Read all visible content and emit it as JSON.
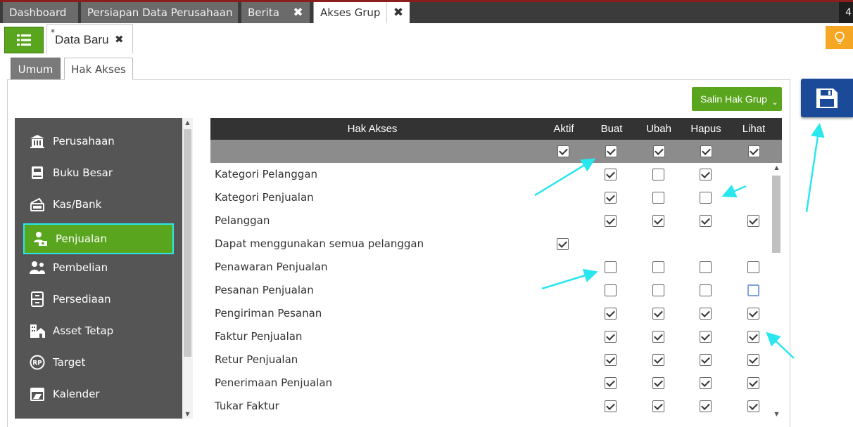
{
  "top_tabs": [
    {
      "label": "Dashboard"
    },
    {
      "label": "Persiapan Data Perusahaan"
    },
    {
      "label": "Berita"
    },
    {
      "label": "Akses Grup"
    }
  ],
  "top_right_text": "4",
  "doc_tab": {
    "modified_marker": "*",
    "label": "Data Baru",
    "close_glyph": "✖"
  },
  "sub_tabs": {
    "umum": "Umum",
    "hak_akses": "Hak Akses"
  },
  "salin_button": {
    "label": "Salin Hak Grup",
    "chevron": "⌄"
  },
  "sidebar": {
    "items": [
      {
        "label": "Perusahaan",
        "icon": "building-icon"
      },
      {
        "label": "Buku Besar",
        "icon": "ledger-icon"
      },
      {
        "label": "Kas/Bank",
        "icon": "cash-icon"
      },
      {
        "label": "Penjualan",
        "icon": "sales-icon",
        "active": true
      },
      {
        "label": "Pembelian",
        "icon": "purchase-icon"
      },
      {
        "label": "Persediaan",
        "icon": "inventory-icon"
      },
      {
        "label": "Asset Tetap",
        "icon": "fixed-asset-icon"
      },
      {
        "label": "Target",
        "icon": "target-rp-icon"
      },
      {
        "label": "Kalender",
        "icon": "calendar-icon"
      }
    ]
  },
  "table": {
    "headers": {
      "hak_akses": "Hak Akses",
      "aktif": "Aktif",
      "buat": "Buat",
      "ubah": "Ubah",
      "hapus": "Hapus",
      "lihat": "Lihat"
    },
    "select_all": {
      "aktif": true,
      "buat": true,
      "ubah": true,
      "hapus": true,
      "lihat": true
    },
    "rows": [
      {
        "label": "Kategori Pelanggan",
        "aktif": null,
        "buat": true,
        "ubah": false,
        "hapus": true,
        "lihat": null
      },
      {
        "label": "Kategori Penjualan",
        "aktif": null,
        "buat": true,
        "ubah": false,
        "hapus": false,
        "lihat": null
      },
      {
        "label": "Pelanggan",
        "aktif": null,
        "buat": true,
        "ubah": true,
        "hapus": true,
        "lihat": true
      },
      {
        "label": "Dapat menggunakan semua pelanggan",
        "aktif": true,
        "buat": null,
        "ubah": null,
        "hapus": null,
        "lihat": null
      },
      {
        "label": "Penawaran Penjualan",
        "aktif": null,
        "buat": false,
        "ubah": false,
        "hapus": false,
        "lihat": false
      },
      {
        "label": "Pesanan Penjualan",
        "aktif": null,
        "buat": false,
        "ubah": false,
        "hapus": false,
        "lihat": false
      },
      {
        "label": "Pengiriman Pesanan",
        "aktif": null,
        "buat": true,
        "ubah": true,
        "hapus": true,
        "lihat": true
      },
      {
        "label": "Faktur Penjualan",
        "aktif": null,
        "buat": true,
        "ubah": true,
        "hapus": true,
        "lihat": true
      },
      {
        "label": "Retur Penjualan",
        "aktif": null,
        "buat": true,
        "ubah": true,
        "hapus": true,
        "lihat": true
      },
      {
        "label": "Penerimaan Penjualan",
        "aktif": null,
        "buat": true,
        "ubah": true,
        "hapus": true,
        "lihat": true
      },
      {
        "label": "Tukar Faktur",
        "aktif": null,
        "buat": true,
        "ubah": true,
        "hapus": true,
        "lihat": true
      }
    ]
  },
  "colors": {
    "accent_green": "#5aa51e",
    "save_blue": "#1b4a99",
    "highlight_cyan": "#29e6ef",
    "sidebar_bg": "#555555",
    "header_dark": "#333333",
    "bulb_orange": "#f5a623"
  }
}
